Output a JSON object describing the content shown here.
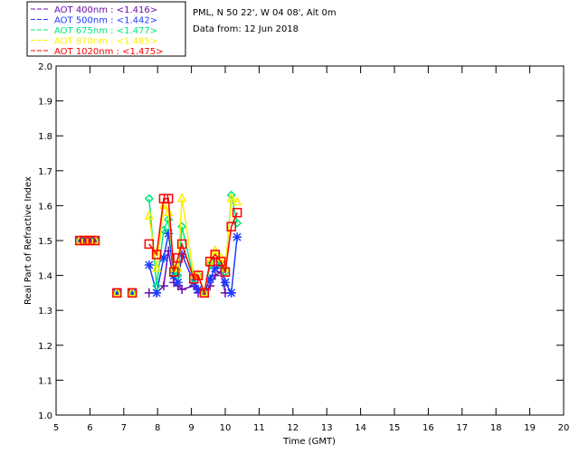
{
  "header": {
    "site": "PML, N 50 22', W 04 08', Alt 0m",
    "date": "Data from: 12 Jun 2018"
  },
  "chart_data": {
    "type": "line",
    "title": "",
    "xlabel": "Time (GMT)",
    "ylabel": "Real Part of Refractive Index",
    "xlim": [
      5,
      20
    ],
    "ylim": [
      1.0,
      2.0
    ],
    "xticks": [
      "5",
      "6",
      "7",
      "8",
      "9",
      "10",
      "11",
      "12",
      "13",
      "14",
      "15",
      "16",
      "17",
      "18",
      "19",
      "20"
    ],
    "yticks": [
      "1.0",
      "1.1",
      "1.2",
      "1.3",
      "1.4",
      "1.5",
      "1.6",
      "1.7",
      "1.8",
      "1.9",
      "2.0"
    ],
    "grid": false,
    "legend_position": "top-left-outside",
    "x": [
      5.7,
      5.85,
      6.0,
      6.15,
      6.8,
      7.25,
      7.75,
      7.97,
      8.18,
      8.32,
      8.48,
      8.6,
      8.72,
      9.07,
      9.2,
      9.38,
      9.55,
      9.7,
      9.87,
      10.0,
      10.18,
      10.35
    ],
    "series": [
      {
        "name": "AOT  400nm : <1.416>",
        "color": "#6a0dad",
        "marker": "plus",
        "values": [
          1.5,
          1.5,
          1.5,
          1.5,
          1.35,
          1.35,
          1.35,
          1.35,
          1.37,
          1.47,
          1.38,
          1.37,
          1.36,
          1.37,
          1.35,
          1.35,
          1.37,
          1.4,
          1.41,
          1.35,
          1.35,
          null
        ]
      },
      {
        "name": "AOT  500nm : <1.442>",
        "color": "#1a3cff",
        "marker": "asterisk",
        "values": [
          1.5,
          1.5,
          1.5,
          1.5,
          1.35,
          1.35,
          1.43,
          1.35,
          1.45,
          1.52,
          1.4,
          1.38,
          1.46,
          1.38,
          1.36,
          1.35,
          1.39,
          1.42,
          1.43,
          1.38,
          1.35,
          1.51
        ]
      },
      {
        "name": "AOT  675nm : <1.477>",
        "color": "#00e87a",
        "marker": "diamond",
        "values": [
          1.5,
          1.5,
          1.5,
          1.5,
          1.35,
          1.35,
          1.62,
          1.37,
          1.53,
          1.56,
          1.41,
          1.4,
          1.54,
          1.39,
          1.4,
          1.35,
          1.43,
          1.45,
          1.43,
          1.41,
          1.63,
          1.55
        ]
      },
      {
        "name": "AOT  870nm : <1.485>",
        "color": "#ffee00",
        "marker": "triangle",
        "values": [
          1.5,
          1.5,
          1.5,
          1.5,
          1.35,
          1.35,
          1.57,
          1.42,
          1.6,
          1.58,
          1.42,
          1.42,
          1.62,
          1.4,
          1.4,
          1.35,
          1.44,
          1.47,
          1.45,
          1.42,
          1.62,
          1.61
        ]
      },
      {
        "name": "AOT 1020nm : <1.475>",
        "color": "#ff0000",
        "marker": "square",
        "values": [
          1.5,
          1.5,
          1.5,
          1.5,
          1.35,
          1.35,
          1.49,
          1.46,
          1.62,
          1.62,
          1.41,
          1.45,
          1.49,
          1.39,
          1.4,
          1.35,
          1.44,
          1.46,
          1.44,
          1.41,
          1.54,
          1.58
        ]
      }
    ]
  }
}
